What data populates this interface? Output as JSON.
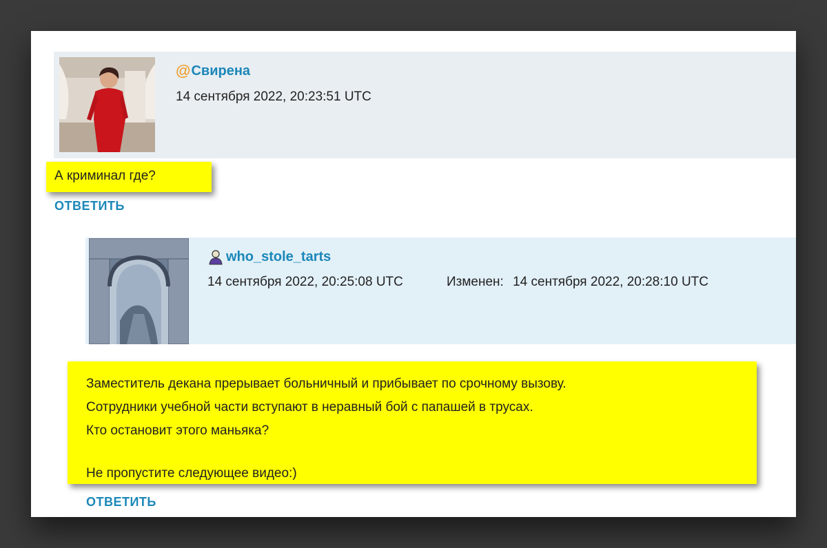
{
  "comments": [
    {
      "username": "Свирена",
      "avatar_icon": "user-photo",
      "user_icon": "at-icon",
      "timestamp": "14 сентября 2022, 20:23:51 UTC",
      "text": "А криминал где?",
      "reply_label": "ОТВЕТИТЬ"
    },
    {
      "username": "who_stole_tarts",
      "avatar_icon": "user-photo",
      "user_icon": "user-icon",
      "timestamp": "14 сентября 2022, 20:25:08 UTC",
      "edited_label": "Изменен:",
      "edited_timestamp": "14 сентября 2022, 20:28:10 UTC",
      "text_lines": [
        "Заместитель декана прерывает больничный и прибывает по срочному вызову.",
        "Сотрудники учебной части вступают в неравный бой с папашей в трусах.",
        "Кто остановит этого маньяка?",
        "",
        "Не пропустите следующее видео:)"
      ],
      "reply_label": "ОТВЕТИТЬ"
    }
  ],
  "colors": {
    "highlight": "#ffff00",
    "link": "#1b87b8",
    "header1_bg": "#e9eef2",
    "header2_bg": "#e2f0f8",
    "at_icon": "#f0a030"
  }
}
